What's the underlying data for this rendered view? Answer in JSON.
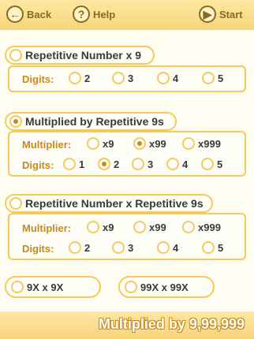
{
  "topbar": {
    "back_label": "Back",
    "help_label": "Help",
    "start_label": "Start"
  },
  "sections": [
    {
      "title": "Repetitive Number x 9",
      "digits_label": "Digits:",
      "digits": [
        "2",
        "3",
        "4",
        "5"
      ],
      "selected_digit": ""
    },
    {
      "title": "Multiplied by Repetitive 9s",
      "multiplier_label": "Multiplier:",
      "multipliers": [
        "x9",
        "x99",
        "x999"
      ],
      "selected_multiplier": "x99",
      "digits_label": "Digits:",
      "digits": [
        "1",
        "2",
        "3",
        "4",
        "5"
      ],
      "selected_digit": "2"
    },
    {
      "title": "Repetitive Number x Repetitive 9s",
      "multiplier_label": "Multiplier:",
      "multipliers": [
        "x9",
        "x99",
        "x999"
      ],
      "digits_label": "Digits:",
      "digits": [
        "2",
        "3",
        "4",
        "5"
      ]
    }
  ],
  "extra_modes": [
    "9X x 9X",
    "99X x 99X"
  ],
  "bottom_title": "Multiplied by 9,99,999",
  "colors": {
    "accent": "#f6c95a",
    "label": "#c98a1a",
    "text": "#3a3a3a",
    "bar": "#f7d47a"
  }
}
